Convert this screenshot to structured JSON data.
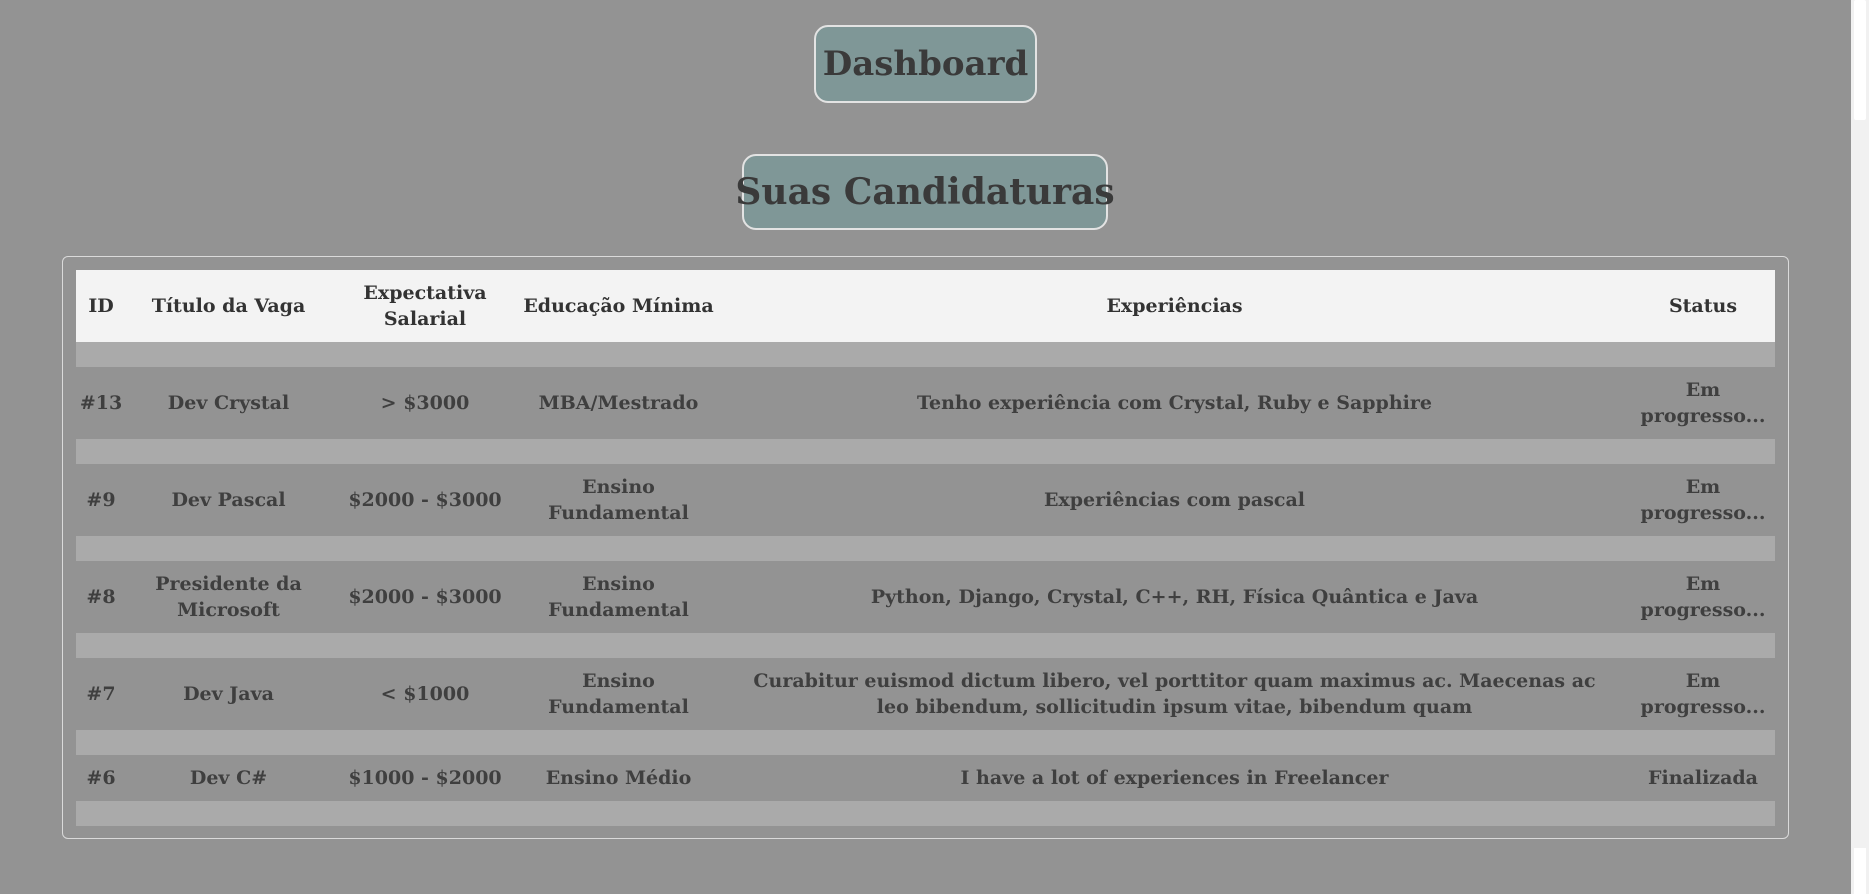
{
  "header": {
    "dashboard_label": "Dashboard",
    "section_title": "Suas Candidaturas"
  },
  "table": {
    "columns": [
      "ID",
      "Título da Vaga",
      "Expectativa Salarial",
      "Educação Mínima",
      "Experiências",
      "Status"
    ],
    "rows": [
      {
        "id": "#13",
        "titulo": "Dev Crystal",
        "salario": "> $3000",
        "educacao": "MBA/Mestrado",
        "experiencias": "Tenho experiência com Crystal, Ruby e Sapphire",
        "status": "Em progresso..."
      },
      {
        "id": "#9",
        "titulo": "Dev Pascal",
        "salario": "$2000 - $3000",
        "educacao": "Ensino Fundamental",
        "experiencias": "Experiências com pascal",
        "status": "Em progresso..."
      },
      {
        "id": "#8",
        "titulo": "Presidente da Microsoft",
        "salario": "$2000 - $3000",
        "educacao": "Ensino Fundamental",
        "experiencias": "Python, Django, Crystal, C++, RH, Física Quântica e Java",
        "status": "Em progresso..."
      },
      {
        "id": "#7",
        "titulo": "Dev Java",
        "salario": "< $1000",
        "educacao": "Ensino Fundamental",
        "experiencias": "Curabitur euismod dictum libero, vel porttitor quam maximus ac. Maecenas ac leo bibendum, sollicitudin ipsum vitae, bibendum quam",
        "status": "Em progresso..."
      },
      {
        "id": "#6",
        "titulo": "Dev C#",
        "salario": "$1000 - $2000",
        "educacao": "Ensino Médio",
        "experiencias": "I have a lot of experiences in Freelancer",
        "status": "Finalizada"
      }
    ]
  },
  "colors": {
    "background": "#939393",
    "pill": "#7f9797",
    "header_row": "#f3f3f3",
    "spacer_row": "#aaaaaa"
  }
}
